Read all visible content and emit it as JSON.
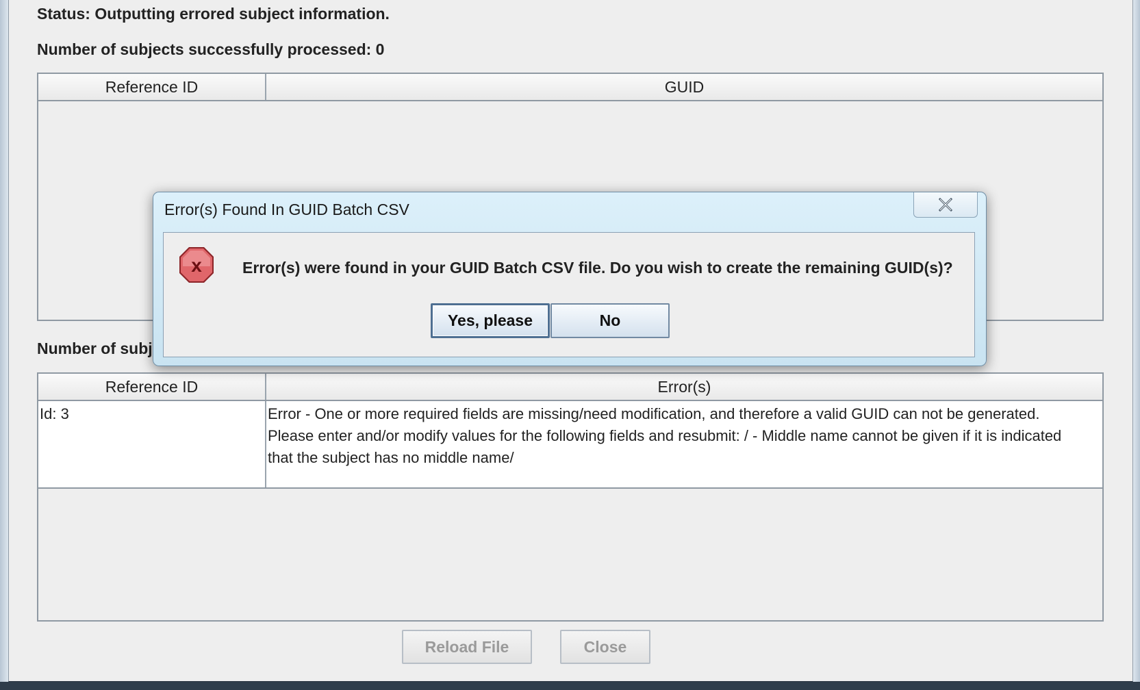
{
  "status": {
    "text": "Status: Outputting errored subject information."
  },
  "success": {
    "label": "Number of subjects successfully processed: 0"
  },
  "success_table": {
    "columns": [
      "Reference ID",
      "GUID"
    ]
  },
  "error_section": {
    "label_partial": "Number of subj"
  },
  "error_table": {
    "columns": [
      "Reference ID",
      "Error(s)"
    ],
    "rows": [
      {
        "reference_id": "Id: 3",
        "error": "Error - One or more required fields are missing/need modification, and therefore a valid GUID can not be generated.  Please enter and/or modify values for the following fields and resubmit: / - Middle name cannot be given if it is indicated that the subject has no middle name/"
      }
    ]
  },
  "footer": {
    "reload_label": "Reload File",
    "close_label": "Close"
  },
  "dialog": {
    "title": "Error(s) Found In GUID Batch CSV",
    "message": "Error(s) were found in your GUID Batch CSV file. Do you wish to create the remaining GUID(s)?",
    "yes_label": "Yes, please",
    "no_label": "No",
    "icon": "error-icon",
    "close_icon": "close-icon"
  },
  "colors": {
    "window_bg": "#eeeeee",
    "dialog_frame": "#c9e3f1",
    "error_icon": "#d9444a",
    "table_border": "#8f99a3"
  }
}
